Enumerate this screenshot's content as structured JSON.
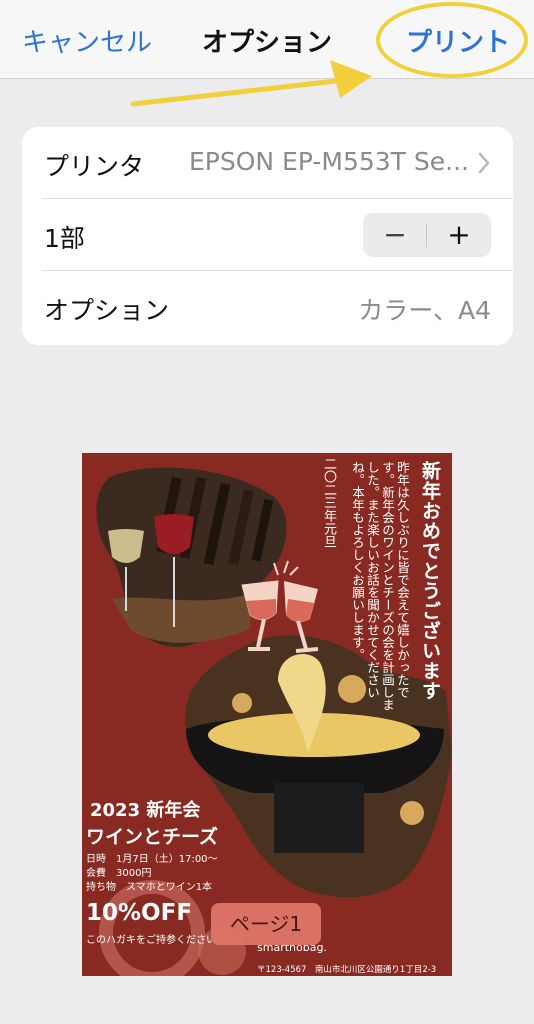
{
  "navbar": {
    "cancel_label": "キャンセル",
    "title": "オプション",
    "print_label": "プリント"
  },
  "options": {
    "printer_label": "プリンタ",
    "printer_value": "EPSON EP-M553T Se...",
    "copies_label": "1部",
    "stepper_minus": "−",
    "stepper_plus": "+",
    "options_label": "オプション",
    "options_value": "カラー、A4"
  },
  "preview": {
    "headline": "新年おめでとうございます",
    "body": "昨年は久しぶりに皆で会えて嬉しかったです。新年会のワインとチーズの会を計画しました。また楽しいお話を聞かせてくださいね。本年もよろしくお願いします。",
    "date": "二〇二三年元旦",
    "event_year": "2023 新年会",
    "event_theme": "ワインとチーズ",
    "info_date": "日時　1月7日（土）17:00～",
    "info_fee": "会費　3000円",
    "info_bring": "持ち物　スマホとワイン1本",
    "off_text": "10%OFF",
    "postcard_text": "このハガキをご持参ください",
    "brand": "smarthobag.",
    "address": "〒123-4567　南山市北川区公園通り1丁目2-3",
    "page_label": "ページ1"
  },
  "colors": {
    "accent": "#2b74d6",
    "highlight": "#f2cf3c",
    "poster_bg": "#892a22",
    "badge": "#dd7668"
  },
  "icons": {
    "chevron": "chevron-right-icon",
    "arrow": "annotation-arrow-icon",
    "glasses": "wine-glasses-icon"
  }
}
